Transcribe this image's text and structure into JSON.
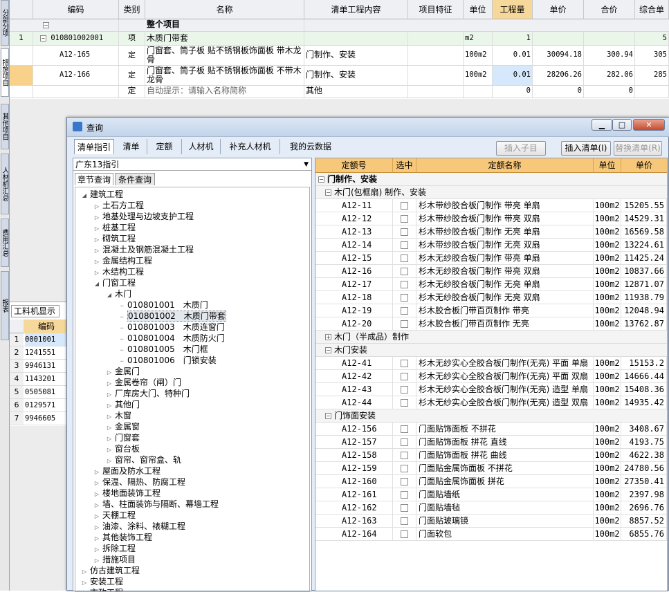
{
  "side_tabs": [
    "分部分项",
    "措施项目",
    "其他项目",
    "人材机汇总",
    "费用汇总",
    "报表"
  ],
  "top_grid": {
    "columns": [
      "编码",
      "类别",
      "名称",
      "清单工程内容",
      "项目特征",
      "单位",
      "工程量",
      "单价",
      "合价",
      "综合单"
    ],
    "section_row": {
      "name": "整个项目"
    },
    "rows": [
      {
        "num": "1",
        "code": "010801002001",
        "type": "项",
        "name": "木质门带套",
        "content": "",
        "feature": "",
        "unit": "m2",
        "qty": "1",
        "price": "",
        "total": "",
        "comp": "5"
      },
      {
        "num": "",
        "code": "A12-165",
        "type": "定",
        "name": "门窗套、筒子板 贴不锈钢板饰面板 带木龙骨",
        "content": "门制作、安装",
        "feature": "",
        "unit": "100m2",
        "qty": "0.01",
        "price": "30094.18",
        "total": "300.94",
        "comp": "305"
      },
      {
        "num": "",
        "code": "A12-166",
        "type": "定",
        "name": "门窗套、筒子板 贴不锈钢板饰面板 不带木龙骨",
        "content": "门制作、安装",
        "feature": "",
        "unit": "100m2",
        "qty": "0.01",
        "price": "28206.26",
        "total": "282.06",
        "comp": "285"
      },
      {
        "num": "",
        "code": "",
        "type": "定",
        "name": "自动提示：请输入名称简称",
        "content": "其他",
        "feature": "",
        "unit": "",
        "qty": "0",
        "price": "0",
        "total": "0",
        "comp": ""
      }
    ]
  },
  "labor_panel": {
    "tab": "工料机显示",
    "header": "编码",
    "rows": [
      {
        "num": "1",
        "code": "0001001"
      },
      {
        "num": "2",
        "code": "1241551"
      },
      {
        "num": "3",
        "code": "9946131"
      },
      {
        "num": "4",
        "code": "1143201"
      },
      {
        "num": "5",
        "code": "0505081"
      },
      {
        "num": "6",
        "code": "0129571"
      },
      {
        "num": "7",
        "code": "9946605"
      }
    ]
  },
  "dialog": {
    "title": "查询",
    "tabs": [
      "清单指引",
      "清单",
      "定额",
      "人材机",
      "补充人材机",
      "我的云数据"
    ],
    "buttons": {
      "insert_child": "插入子目",
      "insert_list": "插入清单(I)",
      "replace_list": "替换清单(R)"
    },
    "combo_value": "广东13指引",
    "subtabs": [
      "章节查询",
      "条件查询"
    ],
    "tree": [
      {
        "label": "建筑工程",
        "level": 0,
        "open": true
      },
      {
        "label": "土石方工程",
        "level": 1
      },
      {
        "label": "地基处理与边坡支护工程",
        "level": 1
      },
      {
        "label": "桩基工程",
        "level": 1
      },
      {
        "label": "砌筑工程",
        "level": 1
      },
      {
        "label": "混凝土及钢筋混凝土工程",
        "level": 1
      },
      {
        "label": "金属结构工程",
        "level": 1
      },
      {
        "label": "木结构工程",
        "level": 1
      },
      {
        "label": "门窗工程",
        "level": 1,
        "open": true
      },
      {
        "label": "木门",
        "level": 2,
        "open": true
      },
      {
        "label": "010801001　木质门",
        "level": 3,
        "leaf": true
      },
      {
        "label": "010801002　木质门带套",
        "level": 3,
        "leaf": true,
        "selected": true
      },
      {
        "label": "010801003　木质连窗门",
        "level": 3,
        "leaf": true
      },
      {
        "label": "010801004　木质防火门",
        "level": 3,
        "leaf": true
      },
      {
        "label": "010801005　木门框",
        "level": 3,
        "leaf": true
      },
      {
        "label": "010801006　门锁安装",
        "level": 3,
        "leaf": true
      },
      {
        "label": "金属门",
        "level": 2
      },
      {
        "label": "金属卷帘（闸）门",
        "level": 2
      },
      {
        "label": "厂库房大门、特种门",
        "level": 2
      },
      {
        "label": "其他门",
        "level": 2
      },
      {
        "label": "木窗",
        "level": 2
      },
      {
        "label": "金属窗",
        "level": 2
      },
      {
        "label": "门窗套",
        "level": 2
      },
      {
        "label": "窗台板",
        "level": 2
      },
      {
        "label": "窗帘、窗帘盒、轨",
        "level": 2
      },
      {
        "label": "屋面及防水工程",
        "level": 1
      },
      {
        "label": "保温、隔热、防腐工程",
        "level": 1
      },
      {
        "label": "楼地面装饰工程",
        "level": 1
      },
      {
        "label": "墙、柱面装饰与隔断、幕墙工程",
        "level": 1
      },
      {
        "label": "天棚工程",
        "level": 1
      },
      {
        "label": "油漆、涂料、裱糊工程",
        "level": 1
      },
      {
        "label": "其他装饰工程",
        "level": 1
      },
      {
        "label": "拆除工程",
        "level": 1
      },
      {
        "label": "措施项目",
        "level": 1
      },
      {
        "label": "仿古建筑工程",
        "level": 0
      },
      {
        "label": "安装工程",
        "level": 0
      },
      {
        "label": "市政工程",
        "level": 0
      }
    ],
    "right_columns": [
      "定额号",
      "选中",
      "定额名称",
      "单位",
      "单价"
    ],
    "right_groups": [
      {
        "title": "门制作、安装",
        "level": 0,
        "sign": "−",
        "rows": []
      },
      {
        "title": "木门(包框扇) 制作、安装",
        "level": 1,
        "sign": "−",
        "rows": [
          {
            "code": "A12-11",
            "name": "杉木带纱胶合板门制作 带亮 单扇",
            "unit": "100m2",
            "price": "15205.55"
          },
          {
            "code": "A12-12",
            "name": "杉木带纱胶合板门制作 带亮 双扇",
            "unit": "100m2",
            "price": "14529.31"
          },
          {
            "code": "A12-13",
            "name": "杉木带纱胶合板门制作 无亮 单扇",
            "unit": "100m2",
            "price": "16569.58"
          },
          {
            "code": "A12-14",
            "name": "杉木带纱胶合板门制作 无亮 双扇",
            "unit": "100m2",
            "price": "13224.61"
          },
          {
            "code": "A12-15",
            "name": "杉木无纱胶合板门制作 带亮 单扇",
            "unit": "100m2",
            "price": "11425.24"
          },
          {
            "code": "A12-16",
            "name": "杉木无纱胶合板门制作 带亮 双扇",
            "unit": "100m2",
            "price": "10837.66"
          },
          {
            "code": "A12-17",
            "name": "杉木无纱胶合板门制作 无亮 单扇",
            "unit": "100m2",
            "price": "12871.07"
          },
          {
            "code": "A12-18",
            "name": "杉木无纱胶合板门制作 无亮 双扇",
            "unit": "100m2",
            "price": "11938.79"
          },
          {
            "code": "A12-19",
            "name": "杉木胶合板门带百页制作 带亮",
            "unit": "100m2",
            "price": "12048.94"
          },
          {
            "code": "A12-20",
            "name": "杉木胶合板门带百页制作 无亮",
            "unit": "100m2",
            "price": "13762.87"
          }
        ]
      },
      {
        "title": "木门（半成品）制作",
        "level": 1,
        "sign": "+",
        "rows": []
      },
      {
        "title": "木门安装",
        "level": 1,
        "sign": "−",
        "rows": [
          {
            "code": "A12-41",
            "name": "杉木无纱实心全胶合板门制作(无亮) 平面 单扇",
            "unit": "100m2",
            "price": "15153.2"
          },
          {
            "code": "A12-42",
            "name": "杉木无纱实心全胶合板门制作(无亮) 平面 双扇",
            "unit": "100m2",
            "price": "14666.44"
          },
          {
            "code": "A12-43",
            "name": "杉木无纱实心全胶合板门制作(无亮) 造型 单扇",
            "unit": "100m2",
            "price": "15408.36"
          },
          {
            "code": "A12-44",
            "name": "杉木无纱实心全胶合板门制作(无亮) 造型 双扇",
            "unit": "100m2",
            "price": "14935.42"
          }
        ]
      },
      {
        "title": "门饰面安装",
        "level": 1,
        "sign": "−",
        "rows": [
          {
            "code": "A12-156",
            "name": "门面贴饰面板 不拼花",
            "unit": "100m2",
            "price": "3408.67"
          },
          {
            "code": "A12-157",
            "name": "门面贴饰面板 拼花 直线",
            "unit": "100m2",
            "price": "4193.75"
          },
          {
            "code": "A12-158",
            "name": "门面贴饰面板 拼花 曲线",
            "unit": "100m2",
            "price": "4622.38"
          },
          {
            "code": "A12-159",
            "name": "门面贴金属饰面板 不拼花",
            "unit": "100m2",
            "price": "24780.56"
          },
          {
            "code": "A12-160",
            "name": "门面贴金属饰面板 拼花",
            "unit": "100m2",
            "price": "27350.41"
          },
          {
            "code": "A12-161",
            "name": "门面贴墙纸",
            "unit": "100m2",
            "price": "2397.98"
          },
          {
            "code": "A12-162",
            "name": "门面贴墙毡",
            "unit": "100m2",
            "price": "2696.76"
          },
          {
            "code": "A12-163",
            "name": "门面贴玻璃镜",
            "unit": "100m2",
            "price": "8857.52"
          },
          {
            "code": "A12-164",
            "name": "门面软包",
            "unit": "100m2",
            "price": "6855.76"
          }
        ]
      }
    ]
  }
}
